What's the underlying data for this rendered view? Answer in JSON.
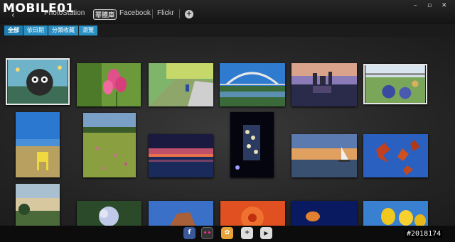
{
  "app": {
    "logo": "MOBILE01",
    "logo_badge": "幂體庫",
    "back": "‹"
  },
  "tabs": [
    {
      "label": "PhotoStation"
    },
    {
      "label": "Facebook"
    },
    {
      "label": "Flickr"
    }
  ],
  "add_tab_icon": "+",
  "window_controls": [
    "–",
    "▫",
    "✕"
  ],
  "subtabs": [
    {
      "label": "全部",
      "active": true
    },
    {
      "label": "依日期"
    },
    {
      "label": "分類收藏"
    },
    {
      "label": "瀏覽"
    }
  ],
  "photos": [
    {
      "name": "cat-painting"
    },
    {
      "name": "pink-flower"
    },
    {
      "name": "garden-path"
    },
    {
      "name": "bridge-river"
    },
    {
      "name": "city-skyline-night"
    },
    {
      "name": "flower-field-fence"
    },
    {
      "name": "field-chair"
    },
    {
      "name": "wildflower-meadow"
    },
    {
      "name": "sunset-lake"
    },
    {
      "name": "night-building"
    },
    {
      "name": "sailboat-lake"
    },
    {
      "name": "red-leaves"
    },
    {
      "name": "evening-trees"
    },
    {
      "name": "hydrangea"
    },
    {
      "name": "rock-sky"
    },
    {
      "name": "orange-flower"
    },
    {
      "name": "jellyfish"
    },
    {
      "name": "yellow-tulips"
    }
  ],
  "dock": [
    {
      "icon": "facebook-icon",
      "label": "f",
      "color": "#3b5998"
    },
    {
      "icon": "flickr-icon",
      "label": "••",
      "color": "#333333"
    },
    {
      "icon": "photo-app-icon",
      "label": "✿",
      "color": "#e8a23a"
    },
    {
      "icon": "add-icon",
      "label": "+",
      "color": "#dddddd"
    },
    {
      "icon": "play-icon",
      "label": "▶",
      "color": "#dddddd"
    }
  ],
  "watermark": "#2018174"
}
